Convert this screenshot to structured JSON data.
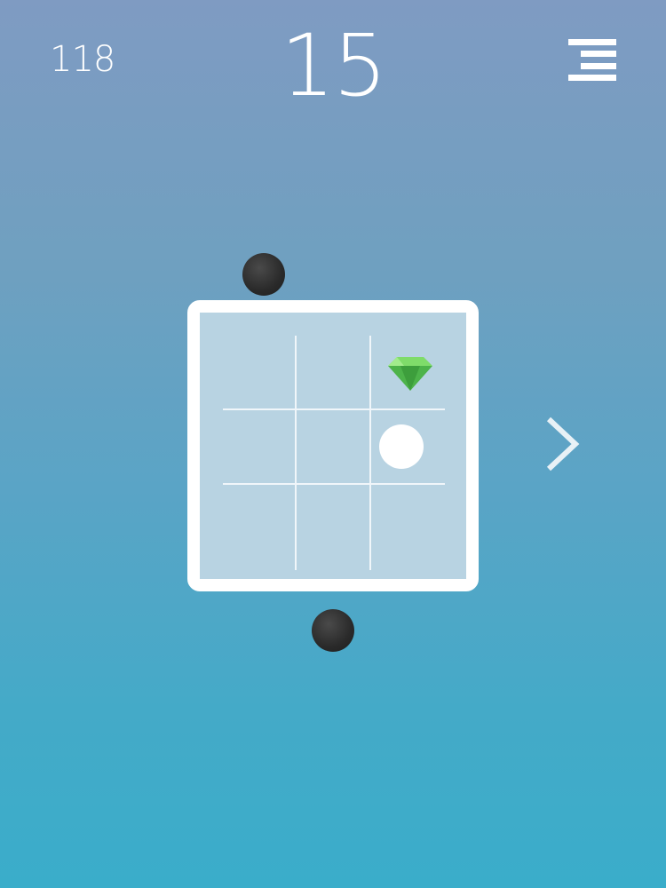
{
  "hud": {
    "best_score": "118",
    "current_score": "15",
    "menu_icon": "hamburger-menu-icon"
  },
  "board": {
    "grid_size": 3,
    "player_cell": {
      "row": 1,
      "col": 2
    },
    "gem_cell": {
      "row": 0,
      "col": 2
    },
    "gem_icon": "diamond-gem-icon",
    "gem_color": "#4db34a",
    "frame_color": "#ffffff",
    "board_color": "#b8d3e2"
  },
  "obstacles": [
    {
      "position": "top",
      "icon": "dark-ball-icon"
    },
    {
      "position": "bottom",
      "icon": "dark-ball-icon"
    }
  ],
  "navigation": {
    "next_icon": "chevron-right-icon"
  },
  "colors": {
    "background_top": "#7f9bc2",
    "background_bottom": "#3aadca",
    "obstacle": "#2a2a2a",
    "player": "#ffffff"
  }
}
